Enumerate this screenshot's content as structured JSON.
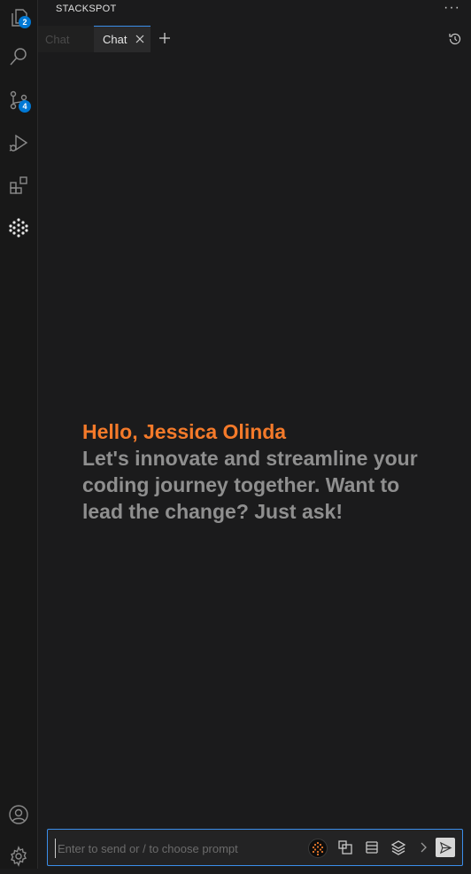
{
  "activity_bar": {
    "explorer_badge": "2",
    "source_control_badge": "4"
  },
  "panel": {
    "title": "STACKSPOT",
    "more": "···"
  },
  "tabs": [
    {
      "label": "Chat",
      "active": false
    },
    {
      "label": "Chat",
      "active": true
    }
  ],
  "greeting": {
    "hello": "Hello, Jessica Olinda",
    "message": "Let's innovate and streamline your coding journey together. Want to lead the change? Just ask!"
  },
  "prompt": {
    "placeholder": "Enter to send or / to choose prompt"
  },
  "colors": {
    "accent": "#3b8eea",
    "greeting_orange": "#f47a2a",
    "badge_blue": "#0078d4"
  }
}
